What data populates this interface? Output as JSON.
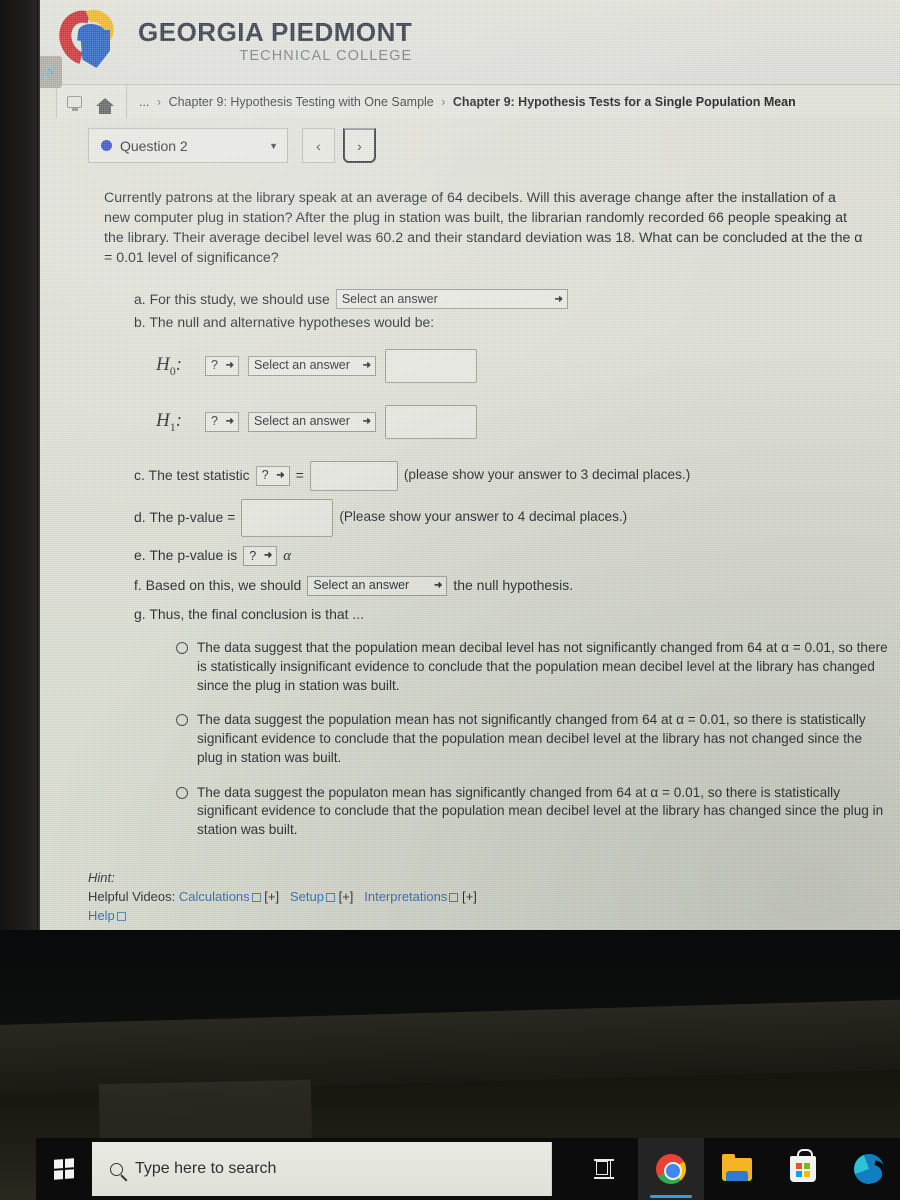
{
  "school": {
    "name_top": "GEORGIA PIEDMONT",
    "name_bottom": "TECHNICAL COLLEGE",
    "logo_colors": {
      "red": "#cf2127",
      "yellow": "#f2b50d",
      "blue": "#1a56c4"
    }
  },
  "breadcrumb": {
    "ellipsis": "...",
    "sep": "›",
    "parent": "Chapter 9: Hypothesis Testing with One Sample",
    "current": "Chapter 9: Hypothesis Tests for a Single Population Mean"
  },
  "question_nav": {
    "question_label": "Question 2",
    "dropdown_caret": "▼",
    "prev_label": "‹",
    "next_label": "›",
    "dot_color": "#2b43c8"
  },
  "question": {
    "stem": "Currently patrons at the library speak at an average of 64 decibels. Will this average change after the installation of a new computer plug in station? After the plug in station was built, the librarian randomly recorded 66 people speaking at the library. Their average decibel level was 60.2 and their standard deviation was 18. What can be concluded at the the α = 0.01 level of significance?",
    "given": {
      "population_mean": 64,
      "sample_size": 66,
      "sample_mean": 60.2,
      "sample_sd": 18,
      "alpha": 0.01
    },
    "part_a": {
      "label": "a. For this study, we should use",
      "select_value": "Select an answer",
      "caret": "❯"
    },
    "part_b": {
      "label": "b. The null and alternative hypotheses would be:",
      "rows": [
        {
          "name": "H",
          "sub": "0",
          "colon": ":",
          "op_select": "?",
          "answer_select": "Select an answer",
          "value_field": ""
        },
        {
          "name": "H",
          "sub": "1",
          "colon": ":",
          "op_select": "?",
          "answer_select": "Select an answer",
          "value_field": ""
        }
      ]
    },
    "part_c": {
      "label": "c. The test statistic",
      "stat_select": "?",
      "equals": "=",
      "value_field": "",
      "note": "(please show your answer to 3 decimal places.)"
    },
    "part_d": {
      "label": "d. The p-value =",
      "value_field": "",
      "note": "(Please show your answer to 4 decimal places.)"
    },
    "part_e": {
      "label": "e. The p-value is",
      "compare_select": "?",
      "alpha_symbol": "α"
    },
    "part_f": {
      "label": "f. Based on this, we should",
      "select_value": "Select an answer",
      "suffix": "the null hypothesis."
    },
    "part_g": {
      "label": "g. Thus, the final conclusion is that ...",
      "options": [
        {
          "selected": false,
          "text_parts": [
            {
              "t": "The data suggest that the population mean decibal level has not ",
              "bold": false
            },
            {
              "t": "significantly",
              "bold": true
            },
            {
              "t": " changed from 64 at α = 0.01, so there is statistically insignificant evidence to conclude that the population mean decibel level at the library has changed since the plug in station was built.",
              "bold": false
            }
          ],
          "full": "The data suggest that the population mean decibal level has not significantly changed from 64 at α = 0.01, so there is statistically insignificant evidence to conclude that the population mean decibel level at the library has changed since the plug in station was built."
        },
        {
          "selected": false,
          "text_parts": [
            {
              "t": "The data suggest the population mean has not ",
              "bold": false
            },
            {
              "t": "significantly",
              "bold": true
            },
            {
              "t": " changed from 64 at α = 0.01, so there is statistically significant evidence to conclude that the population mean decibel level at the library has not changed since the plug in station was built.",
              "bold": false
            }
          ],
          "full": "The data suggest the population mean has not significantly changed from 64 at α = 0.01, so there is statistically significant evidence to conclude that the population mean decibel level at the library has not changed since the plug in station was built."
        },
        {
          "selected": false,
          "text_parts": [
            {
              "t": "The data suggest the populaton mean has ",
              "bold": false
            },
            {
              "t": "significantly",
              "bold": true
            },
            {
              "t": " changed from 64 at α = 0.01, so there is statistically significant evidence to conclude that the population mean decibel level at the library has changed since the plug in station was built.",
              "bold": false
            }
          ],
          "full": "The data suggest the populaton mean has significantly changed from 64 at α = 0.01, so there is statistically significant evidence to conclude that the population mean decibel level at the library has changed since the plug in station was built."
        }
      ]
    }
  },
  "hint": {
    "title": "Hint:",
    "videos_label": "Helpful Videos:",
    "links": [
      {
        "label": "Calculations",
        "toggle": "[+]"
      },
      {
        "label": "Setup",
        "toggle": "[+]"
      },
      {
        "label": "Interpretations",
        "toggle": "[+]"
      }
    ],
    "help_label": "Help",
    "link_color": "#2d6aa8"
  },
  "taskbar": {
    "start_icon": "windows-logo",
    "search_placeholder": "Type here to search",
    "icons": [
      {
        "name": "task-view-icon",
        "active": false
      },
      {
        "name": "chrome-icon",
        "active": true
      },
      {
        "name": "file-explorer-icon",
        "active": false
      },
      {
        "name": "microsoft-store-icon",
        "active": false
      },
      {
        "name": "edge-icon",
        "active": false
      }
    ]
  },
  "left_tab": {
    "glyph": "🔗"
  }
}
